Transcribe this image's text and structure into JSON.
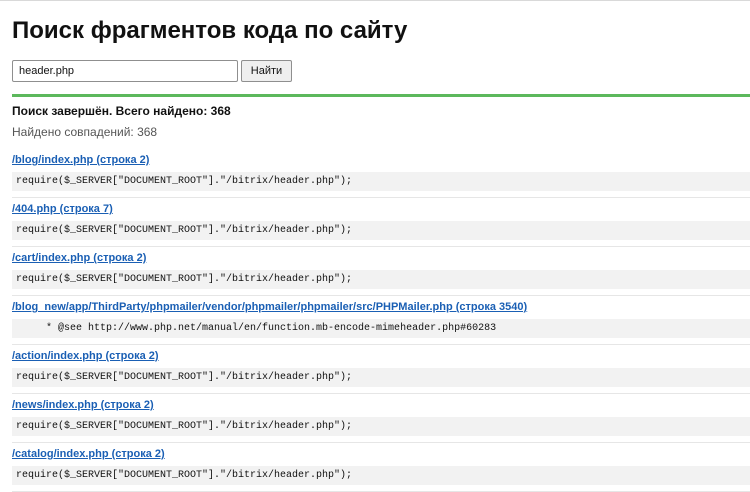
{
  "page": {
    "title": "Поиск фрагментов кода по сайту"
  },
  "search": {
    "value": "header.php",
    "button_label": "Найти"
  },
  "summary": {
    "status": "Поиск завершён. Всего найдено: 368",
    "matches": "Найдено совпадений: 368"
  },
  "colors": {
    "accent_divider": "#5cb85c",
    "link": "#1a5fb4",
    "code_background": "#f2f2f2"
  },
  "results": [
    {
      "link": "/blog/index.php (строка 2)",
      "code": "require($_SERVER[\"DOCUMENT_ROOT\"].\"/bitrix/header.php\");"
    },
    {
      "link": "/404.php (строка 7)",
      "code": "require($_SERVER[\"DOCUMENT_ROOT\"].\"/bitrix/header.php\");"
    },
    {
      "link": "/cart/index.php (строка 2)",
      "code": "require($_SERVER[\"DOCUMENT_ROOT\"].\"/bitrix/header.php\");"
    },
    {
      "link": "/blog_new/app/ThirdParty/phpmailer/vendor/phpmailer/phpmailer/src/PHPMailer.php (строка 3540)",
      "code": "     * @see http://www.php.net/manual/en/function.mb-encode-mimeheader.php#60283"
    },
    {
      "link": "/action/index.php (строка 2)",
      "code": "require($_SERVER[\"DOCUMENT_ROOT\"].\"/bitrix/header.php\");"
    },
    {
      "link": "/news/index.php (строка 2)",
      "code": "require($_SERVER[\"DOCUMENT_ROOT\"].\"/bitrix/header.php\");"
    },
    {
      "link": "/catalog/index.php (строка 2)",
      "code": "require($_SERVER[\"DOCUMENT_ROOT\"].\"/bitrix/header.php\");"
    }
  ]
}
